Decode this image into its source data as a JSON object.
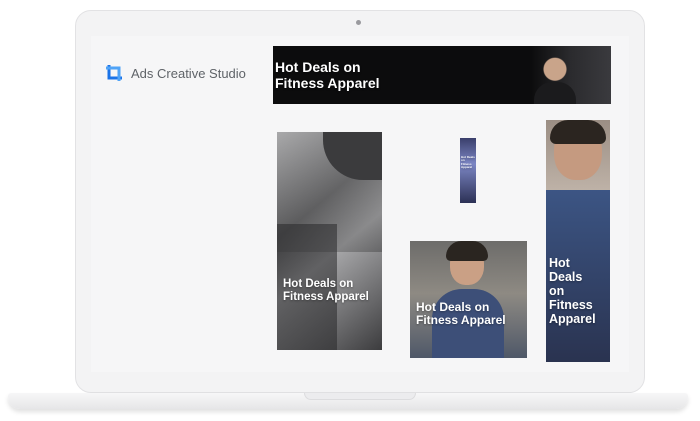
{
  "app": {
    "title": "Ads Creative Studio",
    "brand_color": "#1a73e8"
  },
  "ads": {
    "leaderboard": {
      "line1": "Hot Deals on",
      "line2": "Fitness Apparel"
    },
    "tall": {
      "line1": "Hot Deals on",
      "line2": "Fitness Apparel"
    },
    "skyscraper": {
      "line1": "Hot Deals on",
      "line2": "Fitness Apparel"
    },
    "medium_rectangle": {
      "line1": "Hot Deals on",
      "line2": "Fitness Apparel"
    },
    "right_tall": {
      "lines": [
        "Hot",
        "Deals",
        "on",
        "Fitness",
        "Apparel"
      ]
    }
  }
}
